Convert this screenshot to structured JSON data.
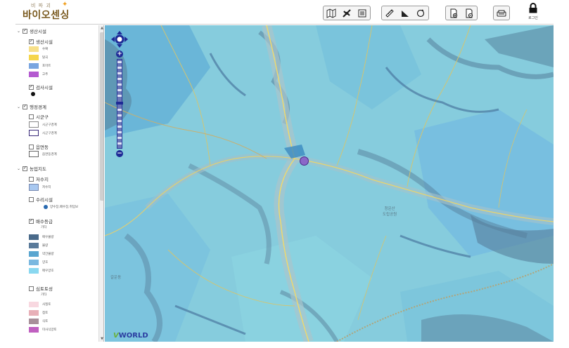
{
  "header": {
    "logo_subtitle": "비 파 괴",
    "logo_title": "바이오센싱",
    "toolbar_groups": [
      {
        "icons": [
          "map-sheet-icon",
          "satellite-icon",
          "layer-list-icon"
        ]
      },
      {
        "icons": [
          "ruler-icon",
          "area-measure-icon",
          "circle-measure-icon"
        ]
      },
      {
        "icons": [
          "export-icon",
          "import-icon"
        ]
      },
      {
        "icons": [
          "print-icon"
        ]
      }
    ],
    "logout_label": "로그인"
  },
  "sidebar": {
    "groups": [
      {
        "label": "생산시설",
        "checked": true,
        "children": [
          {
            "label": "생산시설",
            "checked": true,
            "legend": [
              {
                "color": "#f7e08a",
                "label": "수확"
              },
              {
                "color": "#f5d54a",
                "label": "탈곡"
              },
              {
                "color": "#7aa6e0",
                "label": "포마트"
              },
              {
                "color": "#b45ad0",
                "label": "고추"
              }
            ]
          },
          {
            "label": "검사시설",
            "checked": true
          }
        ]
      },
      {
        "label": "행정경계",
        "checked": true,
        "children": [
          {
            "label": "시군구",
            "checked": false,
            "legend": [
              {
                "color": "#ffffff",
                "border": "#888888",
                "label": "시군구경계"
              },
              {
                "color": "#ffffff",
                "border": "#3a2a7a",
                "label": "시군구경계"
              }
            ]
          },
          {
            "label": "읍면동",
            "checked": false,
            "legend": [
              {
                "color": "#ffffff",
                "border": "#666666",
                "label": "읍면동경계"
              }
            ]
          }
        ]
      },
      {
        "label": "농업지도",
        "checked": true,
        "children": [
          {
            "label": "저수지",
            "checked": false,
            "legend": [
              {
                "color": "#a8c8f0",
                "border": "#7a8ab0",
                "label": "저수지"
              }
            ]
          },
          {
            "label": "수리시설",
            "checked": false,
            "legend_text": "양수장,배수장,취입보"
          },
          {
            "label": "배수등급",
            "checked": true,
            "heading": "기타",
            "legend": [
              {
                "color": "#4a6a8a",
                "label": "매우불량"
              },
              {
                "color": "#5a7a9a",
                "label": "불량"
              },
              {
                "color": "#5aa6d0",
                "label": "약간불량"
              },
              {
                "color": "#7ab8e0",
                "label": "양호"
              },
              {
                "color": "#8ad8f0",
                "label": "매우양호"
              }
            ]
          },
          {
            "label": "심토토성",
            "checked": false,
            "heading": "기타",
            "legend": [
              {
                "color": "#f8d8e0",
                "label": "사질토"
              },
              {
                "color": "#e8b0b8",
                "label": "점토"
              },
              {
                "color": "#a8909a",
                "label": "식토"
              },
              {
                "color": "#c060c0",
                "label": "미사식양토"
              }
            ]
          }
        ]
      }
    ]
  },
  "map": {
    "place_labels": [
      {
        "text": "청운산",
        "sub": "도립공원"
      },
      {
        "text": "갈운동"
      }
    ],
    "attribution": "WORLD",
    "attribution_prefix": "V"
  }
}
